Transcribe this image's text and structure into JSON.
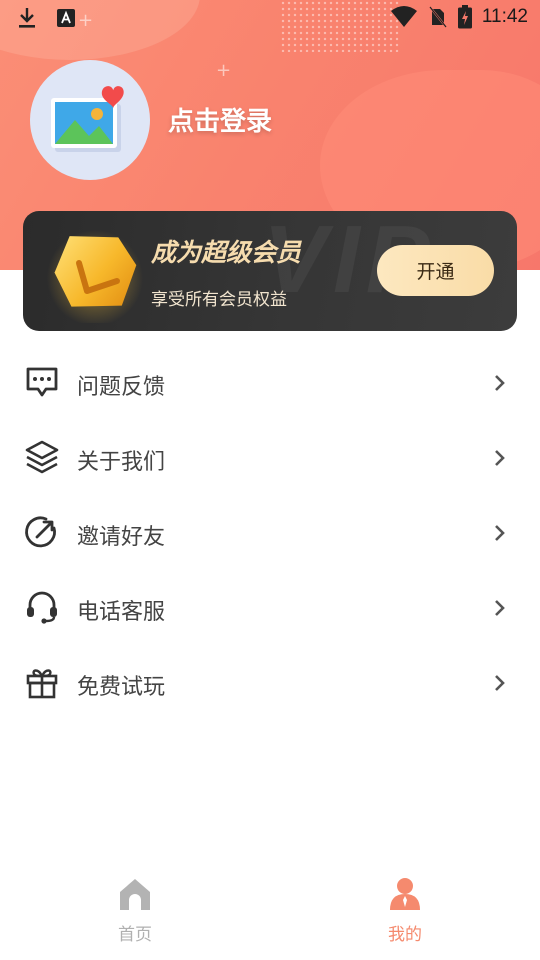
{
  "status_bar": {
    "time": "11:42"
  },
  "profile": {
    "login_label": "点击登录"
  },
  "vip": {
    "title": "成为超级会员",
    "subtitle": "享受所有会员权益",
    "button_label": "开通",
    "watermark": "VIP"
  },
  "menu": {
    "items": [
      {
        "label": "问题反馈",
        "icon": "feedback-icon"
      },
      {
        "label": "关于我们",
        "icon": "layers-icon"
      },
      {
        "label": "邀请好友",
        "icon": "share-arrow-icon"
      },
      {
        "label": "电话客服",
        "icon": "headset-icon"
      },
      {
        "label": "免费试玩",
        "icon": "gift-icon"
      }
    ]
  },
  "tabbar": {
    "tabs": [
      {
        "label": "首页",
        "icon": "home-icon",
        "active": false
      },
      {
        "label": "我的",
        "icon": "profile-icon",
        "active": true
      }
    ]
  },
  "colors": {
    "accent": "#f7796b",
    "vip_gold": "#f6dcae",
    "tab_active": "#f58a6e",
    "tab_inactive": "#b0b0b0"
  }
}
